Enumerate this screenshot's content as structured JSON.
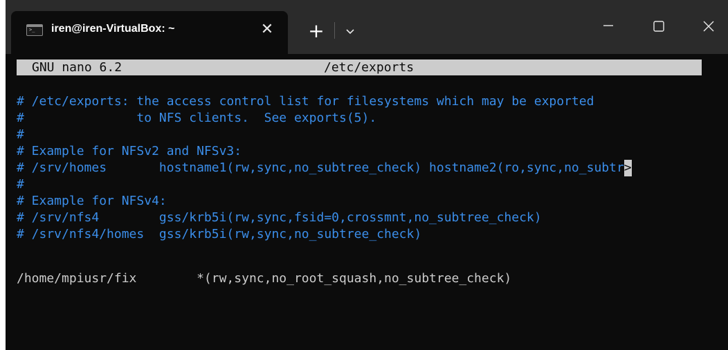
{
  "window": {
    "tab_title": "iren@iren-VirtualBox: ~",
    "tab_icon_prompt": ">_",
    "tab_close_glyph": "✕",
    "new_tab_glyph": "+"
  },
  "nano": {
    "version": "GNU nano 6.2",
    "filename": "/etc/exports"
  },
  "file_lines": [
    "# /etc/exports: the access control list for filesystems which may be exported",
    "#               to NFS clients.  See exports(5).",
    "#",
    "# Example for NFSv2 and NFSv3:",
    "# /srv/homes       hostname1(rw,sync,no_subtree_check) hostname2(ro,sync,no_subtr",
    "#",
    "# Example for NFSv4:",
    "# /srv/nfs4        gss/krb5i(rw,sync,fsid=0,crossmnt,no_subtree_check)",
    "# /srv/nfs4/homes  gss/krb5i(rw,sync,no_subtree_check)",
    "",
    "/home/mpiusr/fix        *(rw,sync,no_root_squash,no_subtree_check)"
  ],
  "overflow_marker": ">",
  "colors": {
    "comment": "#3b8eea",
    "text": "#cccccc",
    "background": "#0c0c0c",
    "titlebar": "#2b2b2b",
    "header_bar": "#cccccc"
  }
}
